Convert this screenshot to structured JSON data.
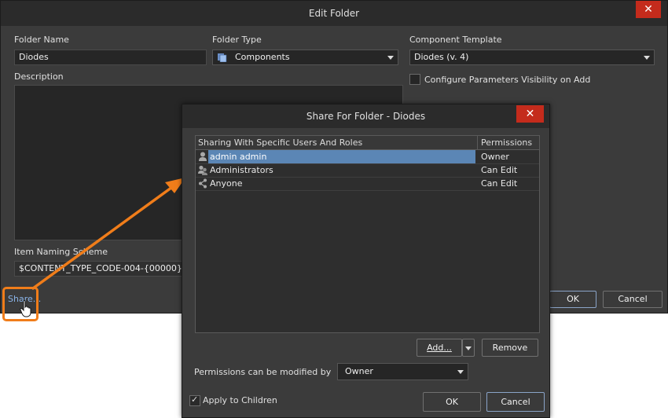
{
  "edit_folder": {
    "title": "Edit Folder",
    "close_label": "✕",
    "folder_name_label": "Folder Name",
    "folder_name_value": "Diodes",
    "folder_type_label": "Folder Type",
    "folder_type_value": "Components",
    "component_template_label": "Component Template",
    "component_template_value": "Diodes (v. 4)",
    "configure_params_label": "Configure Parameters Visibility on Add",
    "description_label": "Description",
    "item_naming_label": "Item Naming Scheme",
    "item_naming_value": "$CONTENT_TYPE_CODE-004-{00000}",
    "share_link": "Share...",
    "ok_label": "OK",
    "cancel_label": "Cancel"
  },
  "share_dialog": {
    "title": "Share For Folder - Diodes",
    "close_label": "✕",
    "columns": [
      "Sharing With Specific Users And Roles",
      "Permissions"
    ],
    "rows": [
      {
        "name": "admin admin",
        "permission": "Owner",
        "icon": "user-icon"
      },
      {
        "name": "Administrators",
        "permission": "Can Edit",
        "icon": "group-icon"
      },
      {
        "name": "Anyone",
        "permission": "Can Edit",
        "icon": "share-icon"
      }
    ],
    "add_label": "Add...",
    "remove_label": "Remove",
    "permissions_modified_label": "Permissions can be modified by",
    "permissions_modified_value": "Owner",
    "apply_children_label": "Apply to Children",
    "apply_children_checked": true,
    "ok_label": "OK",
    "cancel_label": "Cancel"
  },
  "colors": {
    "dialog_bg": "#3b3b3b",
    "close_red": "#c42b1c",
    "selection_blue": "#5b86b5",
    "annotation_orange": "#f07d1a"
  }
}
